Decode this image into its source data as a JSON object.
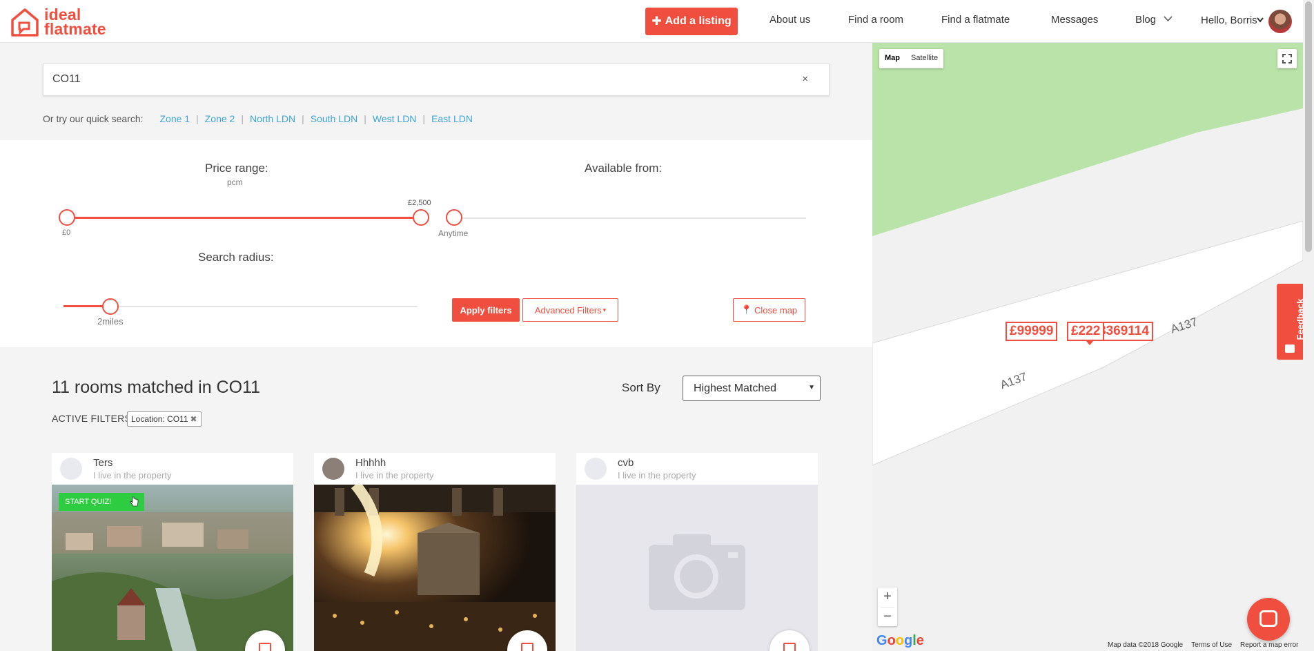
{
  "header": {
    "logo_line1": "ideal",
    "logo_line2": "flatmate",
    "add_listing_label": "Add a listing",
    "nav": {
      "about": "About us",
      "find_room": "Find a room",
      "find_flatmate": "Find a flatmate",
      "messages": "Messages",
      "blog": "Blog"
    },
    "user_greeting": "Hello, Borris"
  },
  "search": {
    "value": "CO11",
    "clear_label": "×",
    "quick_prefix": "Or try our quick search:",
    "quick_links": [
      "Zone 1",
      "Zone 2",
      "North LDN",
      "South LDN",
      "West LDN",
      "East LDN"
    ]
  },
  "filters": {
    "price_label": "Price range:",
    "price_unit": "pcm",
    "price_min_label": "£0",
    "price_max_label": "£2,500",
    "price_min": 0,
    "price_max": 2500,
    "available_label": "Available from:",
    "available_value": "Anytime",
    "radius_label": "Search radius:",
    "radius_value": "2miles",
    "apply_label": "Apply filters",
    "advanced_label": "Advanced Filters",
    "close_map_label": "Close map"
  },
  "results": {
    "title": "11 rooms matched in CO11",
    "sort_label": "Sort By",
    "sort_value": "Highest Matched",
    "active_filters_label": "ACTIVE FILTERS",
    "active_chip": "Location: CO11",
    "cards": [
      {
        "owner": "Ters",
        "subtitle": "I live in the property",
        "quiz": "START QUIZ!"
      },
      {
        "owner": "Hhhhh",
        "subtitle": "I live in the property"
      },
      {
        "owner": "cvb",
        "subtitle": "I live in the property"
      }
    ]
  },
  "map": {
    "type_map": "Map",
    "type_satellite": "Satellite",
    "road_1": "A137",
    "road_2": "A137",
    "price_pins": [
      "£99999",
      "£222",
      "8369114"
    ],
    "feedback_label": "Feedback",
    "zoom_in": "+",
    "zoom_out": "−",
    "google": "Google",
    "attribution": [
      "Map data ©2018 Google",
      "Terms of Use",
      "Report a map error"
    ]
  },
  "colors": {
    "brand": "#f04e3e",
    "link": "#3ea6d8",
    "quiz": "#2ecc40",
    "park": "#b9e3a8"
  }
}
